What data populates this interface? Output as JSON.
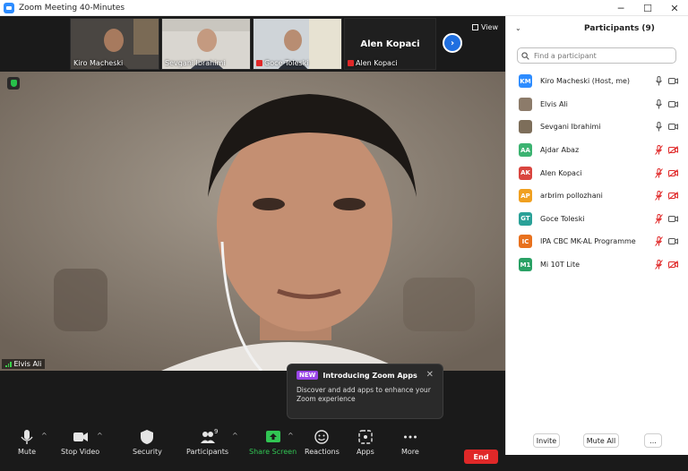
{
  "window": {
    "title": "Zoom Meeting 40-Minutes",
    "minimize": "─",
    "maximize": "☐",
    "close": "✕"
  },
  "thumbnails": [
    {
      "name": "Kiro Macheski",
      "muted": false
    },
    {
      "name": "Sevgani Ibrahimi",
      "muted": false
    },
    {
      "name": "Goce Toleski",
      "muted": true
    },
    {
      "name": "Alen Kopaci",
      "muted": true,
      "display_name": "Alen Kopaci"
    }
  ],
  "view_label": "View",
  "main_speaker": "Elvis Ali",
  "popup": {
    "badge": "NEW",
    "title": "Introducing Zoom Apps",
    "body": "Discover and add apps to enhance your Zoom experience",
    "close": "✕"
  },
  "toolbar": {
    "mute": "Mute",
    "stop_video": "Stop Video",
    "security": "Security",
    "participants": "Participants",
    "participants_count": "9",
    "share_screen": "Share Screen",
    "reactions": "Reactions",
    "apps": "Apps",
    "more": "More",
    "end": "End",
    "caret": "^"
  },
  "panel": {
    "title": "Participants (9)",
    "collapse": "⌄",
    "search_placeholder": "Find a participant",
    "participants": [
      {
        "initials": "KM",
        "name": "Kiro Macheski (Host, me)",
        "color": "#2d8cff",
        "photo": false,
        "mic_on": true,
        "cam_on": true
      },
      {
        "initials": "",
        "name": "Elvis Ali",
        "color": "#8c7b6a",
        "photo": true,
        "mic_on": true,
        "cam_on": true
      },
      {
        "initials": "",
        "name": "Sevgani Ibrahimi",
        "color": "#7d6e5a",
        "photo": true,
        "mic_on": true,
        "cam_on": true
      },
      {
        "initials": "AA",
        "name": "Ajdar Abaz",
        "color": "#3cb371",
        "photo": false,
        "mic_on": false,
        "cam_on": false
      },
      {
        "initials": "AK",
        "name": "Alen Kopaci",
        "color": "#d9453f",
        "photo": false,
        "mic_on": false,
        "cam_on": false
      },
      {
        "initials": "AP",
        "name": "arbrim pollozhani",
        "color": "#f0a020",
        "photo": false,
        "mic_on": false,
        "cam_on": false
      },
      {
        "initials": "GT",
        "name": "Goce Toleski",
        "color": "#2aa198",
        "photo": false,
        "mic_on": false,
        "cam_on": true
      },
      {
        "initials": "IC",
        "name": "IPA CBC MK-AL Programme",
        "color": "#e8711e",
        "photo": false,
        "mic_on": false,
        "cam_on": true
      },
      {
        "initials": "M1",
        "name": "Mi 10T Lite",
        "color": "#2aa165",
        "photo": false,
        "mic_on": false,
        "cam_on": false
      }
    ],
    "invite": "Invite",
    "mute_all": "Mute All",
    "more": "..."
  }
}
